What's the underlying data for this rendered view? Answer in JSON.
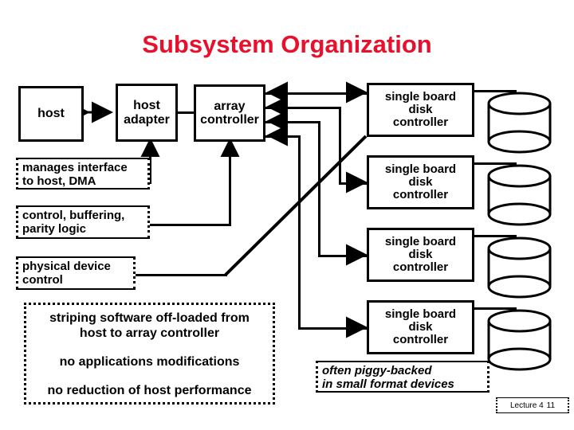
{
  "slide": {
    "title": "Subsystem Organization",
    "title_color": "#e8112d",
    "background": "#ffffff"
  },
  "blocks": {
    "host": "host",
    "host_adapter_line1": "host",
    "host_adapter_line2": "adapter",
    "array_controller_line1": "array",
    "array_controller_line2": "controller",
    "disk_controller_line1": "single board",
    "disk_controller_line2": "disk",
    "disk_controller_line3": "controller"
  },
  "disk_controllers": [
    {
      "line1": "single board",
      "line2": "disk",
      "line3": "controller"
    },
    {
      "line1": "single board",
      "line2": "disk",
      "line3": "controller"
    },
    {
      "line1": "single board",
      "line2": "disk",
      "line3": "controller"
    },
    {
      "line1": "single board",
      "line2": "disk",
      "line3": "controller"
    }
  ],
  "annotations": [
    {
      "line1": "manages interface",
      "line2": "to host, DMA"
    },
    {
      "line1": "control, buffering,",
      "line2": "parity logic"
    },
    {
      "line1": "physical device",
      "line2": "control"
    }
  ],
  "callout": {
    "line1": "striping software off-loaded from",
    "line2": "host to array controller",
    "line3": "no applications modifications",
    "line4": "no reduction of host performance"
  },
  "piggy_note": {
    "line1": "often piggy-backed",
    "line2": "in small format devices"
  },
  "footer": {
    "lecture": "Lecture 4",
    "slide_number": "11"
  }
}
